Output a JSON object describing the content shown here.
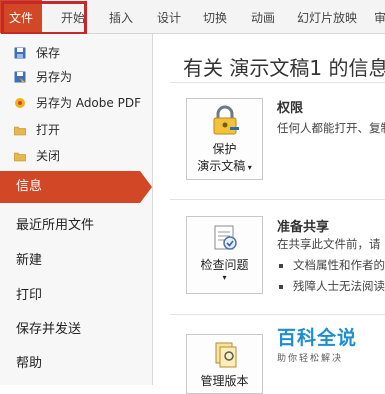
{
  "ribbon": {
    "tabs": [
      "文件",
      "开始",
      "插入",
      "设计",
      "切换",
      "动画",
      "幻灯片放映",
      "审"
    ]
  },
  "sidebar": {
    "small_items": [
      {
        "label": "保存",
        "icon": "save-icon"
      },
      {
        "label": "另存为",
        "icon": "save-as-icon"
      },
      {
        "label": "另存为 Adobe PDF",
        "icon": "pdf-icon"
      },
      {
        "label": "打开",
        "icon": "open-folder-icon"
      },
      {
        "label": "关闭",
        "icon": "close-folder-icon"
      }
    ],
    "active": "信息",
    "big_items": [
      "最近所用文件",
      "新建",
      "打印",
      "保存并发送",
      "帮助"
    ]
  },
  "main": {
    "title": "有关 演示文稿1 的信息",
    "sections": [
      {
        "button_label_1": "保护",
        "button_label_2": "演示文稿",
        "heading": "权限",
        "text": "任何人都能打开、复制"
      },
      {
        "button_label_1": "检查问题",
        "heading": "准备共享",
        "text": "在共享此文件前，请",
        "bullets": [
          "文档属性和作者的",
          "残障人士无法阅读"
        ]
      },
      {
        "button_label_1": "管理版本"
      }
    ]
  },
  "watermark": {
    "title": "百科全说",
    "subtitle": "助你轻松解决"
  }
}
